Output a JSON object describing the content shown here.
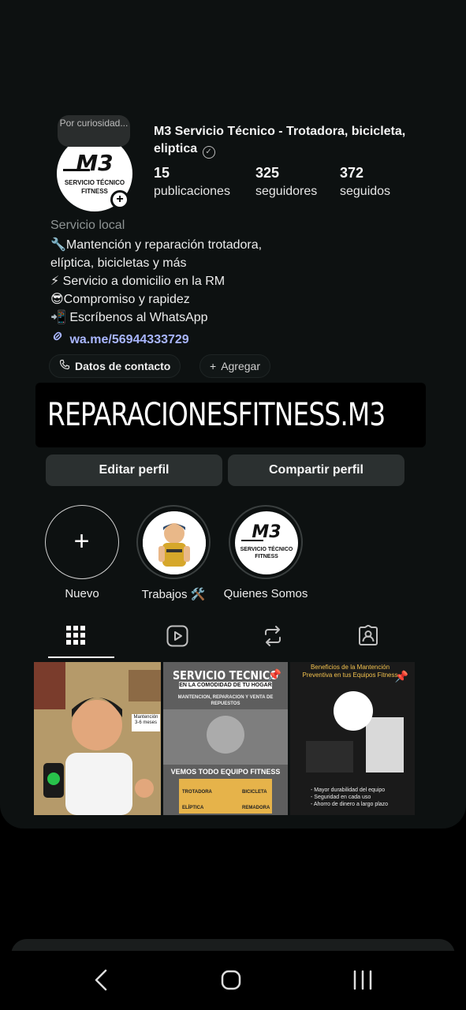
{
  "profile": {
    "note": "Por curiosidad...",
    "name": "M3 Servicio Técnico - Trotadora, bicicleta, eliptica",
    "avatar": {
      "logo_text": "M3",
      "logo_subtitle": "SERVICIO TÉCNICO FITNESS"
    },
    "stats": [
      {
        "value": "15",
        "label": "publicaciones"
      },
      {
        "value": "325",
        "label": "seguidores"
      },
      {
        "value": "372",
        "label": "seguidos"
      }
    ],
    "category": "Servicio local",
    "bio": [
      "🔧Mantención y reparación trotadora,",
      "elíptica, bicicletas y más",
      "⚡ Servicio a domicilio en la RM",
      "😎Compromiso y rapidez",
      "📲 Escríbenos al WhatsApp"
    ],
    "link": "wa.me/56944333729",
    "chips": {
      "contact": "Datos de contacto",
      "add": "Agregar"
    }
  },
  "banner": {
    "text": "REPARACIONESFITNESS.M3"
  },
  "actions": {
    "edit": "Editar perfil",
    "share": "Compartir perfil"
  },
  "highlights": [
    {
      "label": "Nuevo"
    },
    {
      "label": "Trabajos 🛠️"
    },
    {
      "label": "Quienes Somos",
      "logo_text": "M3",
      "logo_subtitle": "SERVICIO TÉCNICO FITNESS"
    }
  ],
  "tabs": [
    {
      "icon": "grid-icon"
    },
    {
      "icon": "reels-icon"
    },
    {
      "icon": "reposts-icon"
    },
    {
      "icon": "tagged-icon"
    }
  ],
  "posts": [
    {
      "caption": "",
      "badge": "Mantención 3-6 meses"
    },
    {
      "caption": "SERVICIO TECNICO",
      "subcaption": "EN LA COMODIDAD DE TU HOGAR",
      "strip": "MANTENCION, REPARACION Y VENTA DE REPUESTOS",
      "footer": "VEMOS TODO EQUIPO FITNESS",
      "items": [
        "TROTADORA",
        "BICICLETA",
        "ELÍPTICA",
        "REMADORA"
      ]
    },
    {
      "caption": "Beneficios de la Mantención Preventiva en tus Equipos Fitness",
      "bullets": [
        "- Mayor durabilidad del equipo",
        "- Seguridad en cada uso",
        "- Ahorro de dinero a largo plazo"
      ]
    }
  ],
  "colors": {
    "background": "#0d1111",
    "link": "#a9b6ff",
    "button": "#2b3030"
  }
}
